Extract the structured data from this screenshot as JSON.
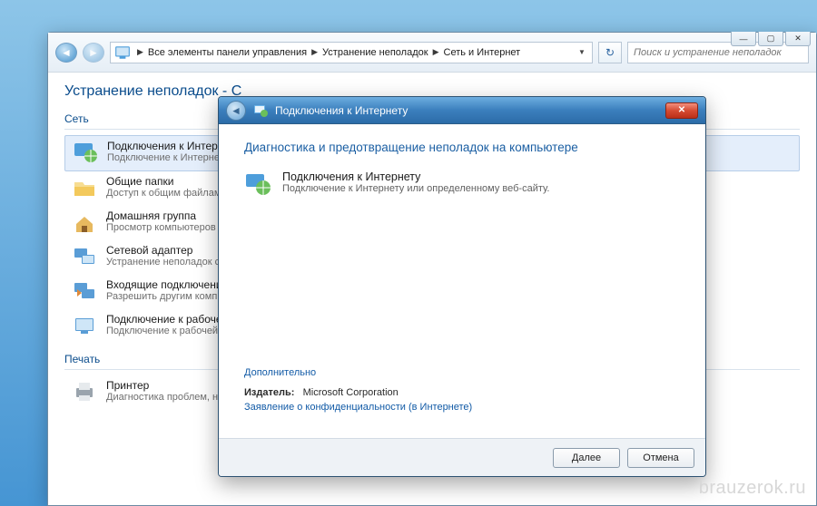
{
  "explorer": {
    "breadcrumb": [
      "Все элементы панели управления",
      "Устранение неполадок",
      "Сеть и Интернет"
    ],
    "search_placeholder": "Поиск и устранение неполадок",
    "page_heading": "Устранение неполадок - С",
    "sections": {
      "network_label": "Сеть",
      "print_label": "Печать"
    },
    "items": [
      {
        "title": "Подключения к Интернет",
        "subtitle": "Подключение к Интернет"
      },
      {
        "title": "Общие папки",
        "subtitle": "Доступ к общим файлам"
      },
      {
        "title": "Домашняя группа",
        "subtitle": "Просмотр компьютеров"
      },
      {
        "title": "Сетевой адаптер",
        "subtitle": "Устранение неполадок се"
      },
      {
        "title": "Входящие подключения",
        "subtitle": "Разрешить другим компь"
      },
      {
        "title": "Подключение к рабочем",
        "subtitle": "Подключение к рабочей"
      }
    ],
    "printer": {
      "title": "Принтер",
      "subtitle": "Диагностика проблем, не"
    }
  },
  "wizard": {
    "title": "Подключения к Интернету",
    "heading": "Диагностика и предотвращение неполадок на компьютере",
    "item": {
      "title": "Подключения к Интернету",
      "subtitle": "Подключение к Интернету или определенному веб-сайту."
    },
    "advanced_link": "Дополнительно",
    "publisher_label": "Издатель:",
    "publisher_value": "Microsoft Corporation",
    "privacy_link": "Заявление о конфиденциальности (в Интернете)",
    "next": "Далее",
    "cancel": "Отмена"
  },
  "watermark": "brauzerok.ru"
}
